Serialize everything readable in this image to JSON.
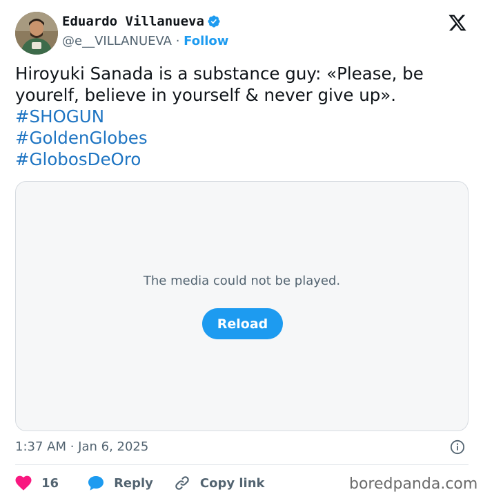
{
  "author": {
    "name": "Eduardo Villanueva",
    "handle": "@e__VILLANUEVA",
    "separator": " · ",
    "follow_label": "Follow"
  },
  "tweet": {
    "text": "Hiroyuki Sanada is a substance guy: «Please, be yourelf, believe in yourself & never give up».",
    "hashtags": [
      "#SHOGUN",
      "#GoldenGlobes",
      "#GlobosDeOro"
    ]
  },
  "media": {
    "message": "The media could not be played.",
    "reload_label": "Reload"
  },
  "timestamp": "1:37 AM · Jan 6, 2025",
  "actions": {
    "like_count": "16",
    "reply_label": "Reply",
    "copy_link_label": "Copy link"
  },
  "watermark": "boredpanda.com",
  "colors": {
    "accent": "#1d9bf0",
    "hashtag": "#1d74c2",
    "like": "#f91880",
    "secondary_text": "#536471"
  },
  "icons": [
    "avatar",
    "verified-badge-icon",
    "x-logo-icon",
    "info-icon",
    "heart-icon",
    "reply-bubble-icon",
    "link-icon"
  ]
}
